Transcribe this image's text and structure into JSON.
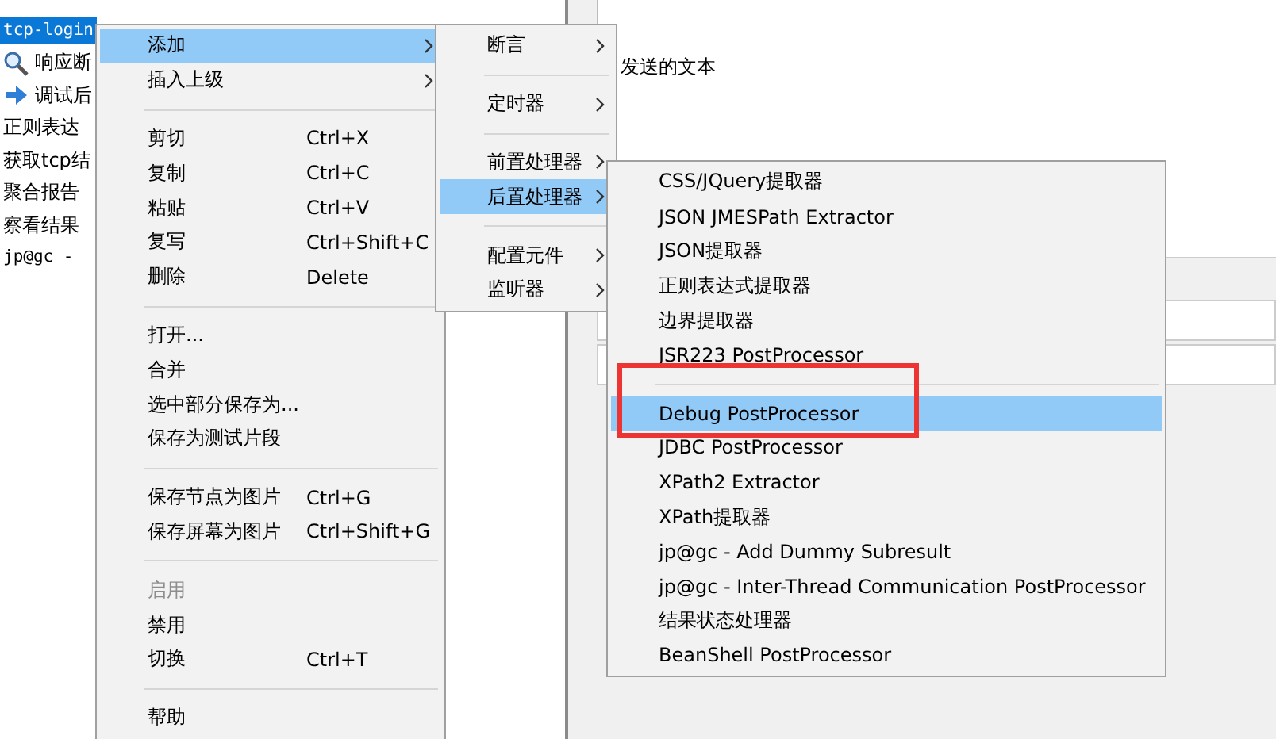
{
  "tree": {
    "items": [
      {
        "label": "tcp-login",
        "kind": "mono",
        "selected": true
      },
      {
        "label": "响应断",
        "kind": "view",
        "selected": false
      },
      {
        "label": "调试后",
        "kind": "sampler",
        "selected": false
      },
      {
        "label": "正则表达",
        "kind": "plain",
        "selected": false
      },
      {
        "label": "获取tcp结",
        "kind": "plain",
        "selected": false
      },
      {
        "label": "聚合报告",
        "kind": "plain",
        "selected": false
      },
      {
        "label": "察看结果",
        "kind": "plain",
        "selected": false
      },
      {
        "label": "jp@gc -",
        "kind": "mono",
        "selected": false
      }
    ]
  },
  "editor": {
    "field_label": "发送的文本"
  },
  "context_menu": {
    "items": [
      {
        "kind": "item",
        "label": "添加",
        "selected": true,
        "disabled": false,
        "submenu": true
      },
      {
        "kind": "item",
        "label": "插入上级",
        "selected": false,
        "disabled": false,
        "submenu": true
      },
      {
        "kind": "separator"
      },
      {
        "kind": "item",
        "label": "剪切",
        "shortcut": "Ctrl+X",
        "selected": false,
        "disabled": false,
        "submenu": false
      },
      {
        "kind": "item",
        "label": "复制",
        "shortcut": "Ctrl+C",
        "selected": false,
        "disabled": false,
        "submenu": false
      },
      {
        "kind": "item",
        "label": "粘贴",
        "shortcut": "Ctrl+V",
        "selected": false,
        "disabled": false,
        "submenu": false
      },
      {
        "kind": "item",
        "label": "复写",
        "shortcut": "Ctrl+Shift+C",
        "selected": false,
        "disabled": false,
        "submenu": false
      },
      {
        "kind": "item",
        "label": "删除",
        "shortcut": "Delete",
        "selected": false,
        "disabled": false,
        "submenu": false
      },
      {
        "kind": "separator"
      },
      {
        "kind": "item",
        "label": "打开...",
        "selected": false,
        "disabled": false,
        "submenu": false
      },
      {
        "kind": "item",
        "label": "合并",
        "selected": false,
        "disabled": false,
        "submenu": false
      },
      {
        "kind": "item",
        "label": "选中部分保存为...",
        "selected": false,
        "disabled": false,
        "submenu": false
      },
      {
        "kind": "item",
        "label": "保存为测试片段",
        "selected": false,
        "disabled": false,
        "submenu": false
      },
      {
        "kind": "separator"
      },
      {
        "kind": "item",
        "label": "保存节点为图片",
        "shortcut": "Ctrl+G",
        "selected": false,
        "disabled": false,
        "submenu": false
      },
      {
        "kind": "item",
        "label": "保存屏幕为图片",
        "shortcut": "Ctrl+Shift+G",
        "selected": false,
        "disabled": false,
        "submenu": false
      },
      {
        "kind": "separator"
      },
      {
        "kind": "item",
        "label": "启用",
        "selected": false,
        "disabled": true,
        "submenu": false
      },
      {
        "kind": "item",
        "label": "禁用",
        "selected": false,
        "disabled": false,
        "submenu": false
      },
      {
        "kind": "item",
        "label": "切换",
        "shortcut": "Ctrl+T",
        "selected": false,
        "disabled": false,
        "submenu": false
      },
      {
        "kind": "separator"
      },
      {
        "kind": "item",
        "label": "帮助",
        "selected": false,
        "disabled": false,
        "submenu": false
      }
    ]
  },
  "add_submenu": {
    "items": [
      {
        "kind": "item",
        "label": "断言",
        "selected": false,
        "disabled": false,
        "submenu": true
      },
      {
        "kind": "separator"
      },
      {
        "kind": "item",
        "label": "定时器",
        "selected": false,
        "disabled": false,
        "submenu": true
      },
      {
        "kind": "separator"
      },
      {
        "kind": "item",
        "label": "前置处理器",
        "selected": false,
        "disabled": false,
        "submenu": true
      },
      {
        "kind": "item",
        "label": "后置处理器",
        "selected": true,
        "disabled": false,
        "submenu": true
      },
      {
        "kind": "separator"
      },
      {
        "kind": "item",
        "label": "配置元件",
        "selected": false,
        "disabled": false,
        "submenu": true
      },
      {
        "kind": "item",
        "label": "监听器",
        "selected": false,
        "disabled": false,
        "submenu": true
      }
    ]
  },
  "postprocessor_submenu": {
    "items": [
      {
        "kind": "item",
        "label": "CSS/JQuery提取器",
        "selected": false,
        "disabled": false,
        "submenu": false
      },
      {
        "kind": "item",
        "label": "JSON JMESPath Extractor",
        "selected": false,
        "disabled": false,
        "submenu": false
      },
      {
        "kind": "item",
        "label": "JSON提取器",
        "selected": false,
        "disabled": false,
        "submenu": false
      },
      {
        "kind": "item",
        "label": "正则表达式提取器",
        "selected": false,
        "disabled": false,
        "submenu": false
      },
      {
        "kind": "item",
        "label": "边界提取器",
        "selected": false,
        "disabled": false,
        "submenu": false
      },
      {
        "kind": "item",
        "label": "JSR223 PostProcessor",
        "selected": false,
        "disabled": false,
        "submenu": false
      },
      {
        "kind": "separator"
      },
      {
        "kind": "item",
        "label": "Debug PostProcessor",
        "selected": true,
        "disabled": false,
        "submenu": false
      },
      {
        "kind": "item",
        "label": "JDBC PostProcessor",
        "selected": false,
        "disabled": false,
        "submenu": false
      },
      {
        "kind": "item",
        "label": "XPath2 Extractor",
        "selected": false,
        "disabled": false,
        "submenu": false
      },
      {
        "kind": "item",
        "label": "XPath提取器",
        "selected": false,
        "disabled": false,
        "submenu": false
      },
      {
        "kind": "item",
        "label": "jp@gc - Add Dummy Subresult",
        "selected": false,
        "disabled": false,
        "submenu": false
      },
      {
        "kind": "item",
        "label": "jp@gc - Inter-Thread Communication PostProcessor",
        "selected": false,
        "disabled": false,
        "submenu": false
      },
      {
        "kind": "item",
        "label": "结果状态处理器",
        "selected": false,
        "disabled": false,
        "submenu": false
      },
      {
        "kind": "item",
        "label": "BeanShell PostProcessor",
        "selected": false,
        "disabled": false,
        "submenu": false
      }
    ]
  }
}
